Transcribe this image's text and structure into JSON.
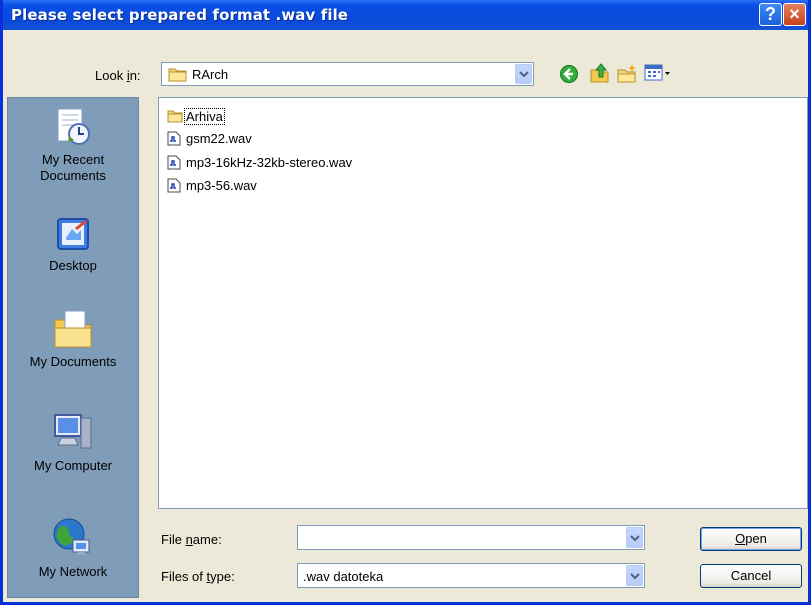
{
  "window": {
    "title": "Please select prepared format .wav file",
    "help_label": "?",
    "close_label": "×"
  },
  "toolbar": {
    "look_in_label": "Look in:",
    "look_in_mnemonic": "i",
    "look_in_value": "RArch",
    "icons": [
      "back-icon",
      "up-folder-icon",
      "new-folder-icon",
      "view-menu-icon"
    ]
  },
  "places": [
    {
      "label_lines": [
        "My Recent",
        "Documents"
      ],
      "icon": "recent-documents-icon"
    },
    {
      "label_lines": [
        "Desktop"
      ],
      "icon": "desktop-icon"
    },
    {
      "label_lines": [
        "My Documents"
      ],
      "icon": "my-documents-icon"
    },
    {
      "label_lines": [
        "My Computer"
      ],
      "icon": "my-computer-icon"
    },
    {
      "label_lines": [
        "My Network"
      ],
      "icon": "my-network-icon"
    }
  ],
  "files": [
    {
      "name": "Arhiva",
      "type": "folder"
    },
    {
      "name": "gsm22.wav",
      "type": "wav"
    },
    {
      "name": "mp3-16kHz-32kb-stereo.wav",
      "type": "wav"
    },
    {
      "name": "mp3-56.wav",
      "type": "wav"
    }
  ],
  "form": {
    "file_name_label": "File name:",
    "file_name_mnemonic": "n",
    "file_name_value": "",
    "files_of_type_label": "Files of type:",
    "files_of_type_mnemonic": "t",
    "files_of_type_value": ".wav datoteka"
  },
  "buttons": {
    "open_label": "Open",
    "open_mnemonic": "O",
    "cancel_label": "Cancel"
  },
  "colors": {
    "titlebar": "#0a4ee6",
    "dialog_bg": "#ece9d8",
    "places_bar": "#7f9db9",
    "input_border": "#7f9db9"
  }
}
